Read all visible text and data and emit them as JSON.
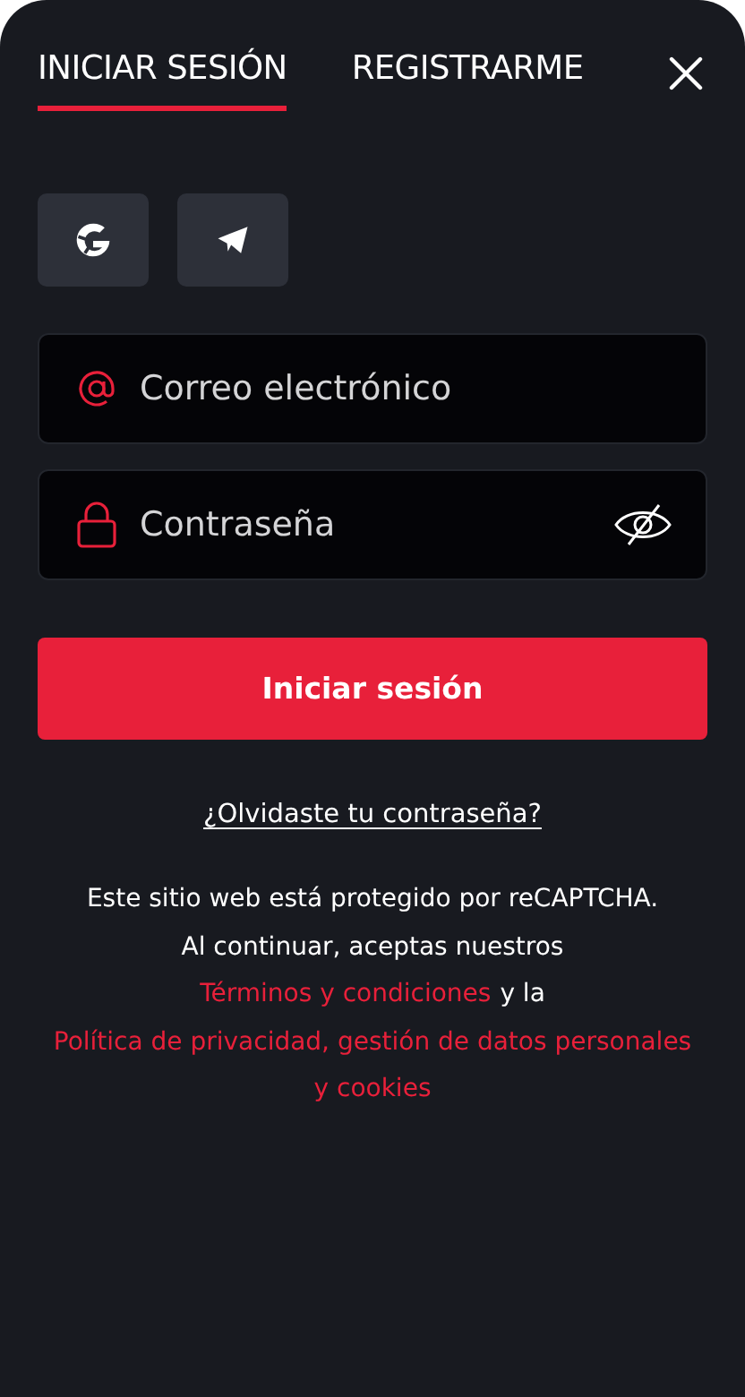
{
  "tabs": [
    {
      "label": "INICIAR SESIÓN",
      "selected": true
    },
    {
      "label": "REGISTRARME",
      "selected": false
    }
  ],
  "social_buttons": [
    {
      "kind": "google"
    },
    {
      "kind": "telegram"
    }
  ],
  "fields": [
    {
      "kind": "email",
      "placeholder": "Correo electrónico"
    },
    {
      "kind": "password",
      "placeholder": "Contraseña",
      "visible": false
    }
  ],
  "submit_button": "Iniciar sesión",
  "forgot_link": "¿Olvidaste tu contraseña?",
  "legal": {
    "recaptcha": "Este sitio web está protegido por reCAPTCHA.",
    "consent": "Al continuar, aceptas nuestros",
    "terms_link": "Términos y condiciones",
    "joiner": "y la",
    "privacy_link": "Política de privacidad, gestión de datos personales y cookies"
  }
}
